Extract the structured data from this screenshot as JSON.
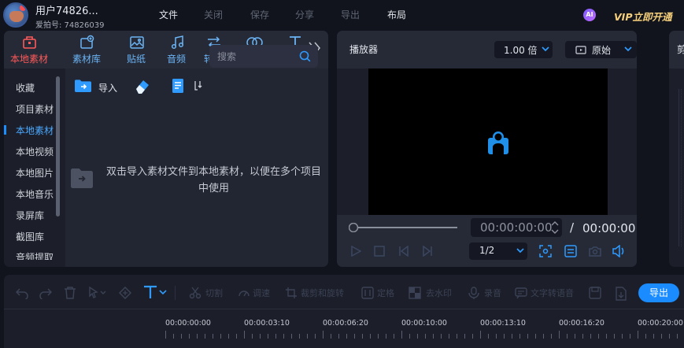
{
  "user": {
    "name": "用户74826...",
    "id_text": "爱拍号: 74826039"
  },
  "menu": [
    "文件",
    "关闭",
    "保存",
    "分享",
    "导出",
    "布局"
  ],
  "ai_badge": "AI",
  "vip_label": "VIP立即开通",
  "media_tabs": [
    "本地素材",
    "素材库",
    "贴纸",
    "音频",
    "转场",
    "滤镜",
    "文字"
  ],
  "sidebar_items": [
    "收藏",
    "项目素材",
    "本地素材",
    "本地视频",
    "本地图片",
    "本地音乐",
    "录屏库",
    "截图库",
    "音频提取"
  ],
  "import_label": "导入",
  "search_placeholder": "搜索",
  "empty_hint": "双击导入素材文件到本地素材，以便在多个项目中使用",
  "player": {
    "title": "播放器",
    "speed": "1.00 倍",
    "aspect": "原始",
    "current_time": "00:00:00:00",
    "separator": "/",
    "total_time": "00:00:00:00",
    "quality": "1/2",
    "progress": 0
  },
  "right_panel_label": "剪",
  "timeline_tools": [
    "切割",
    "调速",
    "裁剪和旋转",
    "定格",
    "去水印",
    "录音",
    "文字转语音"
  ],
  "export_label": "导出",
  "ruler_labels": [
    "00:00:00:00",
    "00:00:03:10",
    "00:00:06:20",
    "00:00:10:00",
    "00:00:13:10",
    "00:00:16:20",
    "00:00:20:00"
  ],
  "colors": {
    "accent": "#1a8cff",
    "active_tab": "#ff5a5a",
    "tab_label": "#6bb4f5",
    "vip": "#f5cf7c"
  },
  "icons": {
    "import": "folder-import-icon",
    "search": "search-icon",
    "more": "double-chevron-right-icon"
  }
}
